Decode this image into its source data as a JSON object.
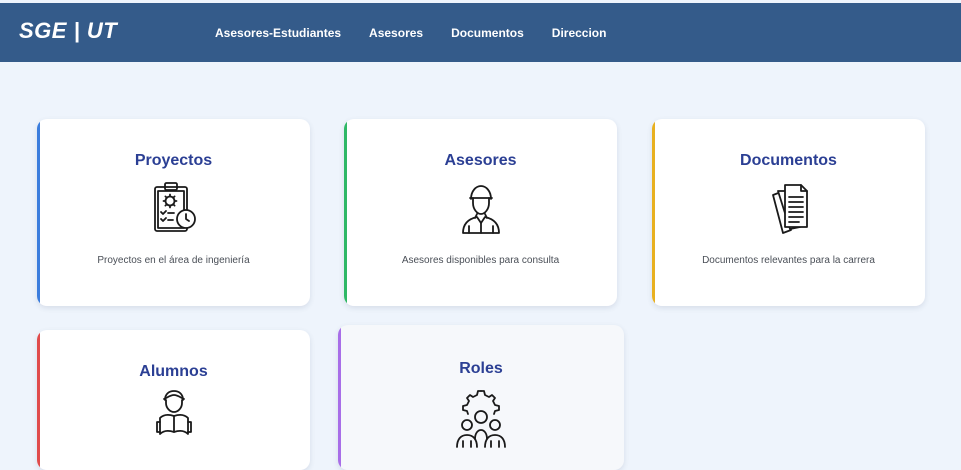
{
  "navbar": {
    "brand": "SGE | UT",
    "links": [
      "Asesores-Estudiantes",
      "Asesores",
      "Documentos",
      "Direccion"
    ]
  },
  "cards": [
    {
      "title": "Proyectos",
      "description": "Proyectos en el área de ingeniería",
      "icon": "clipboard-gear-clock-icon",
      "accent": "#3b7ddd"
    },
    {
      "title": "Asesores",
      "description": "Asesores disponibles para consulta",
      "icon": "advisor-person-icon",
      "accent": "#2fb866"
    },
    {
      "title": "Documentos",
      "description": "Documentos relevantes para la carrera",
      "icon": "documents-stack-icon",
      "accent": "#e8b020"
    },
    {
      "title": "Alumnos",
      "description": "",
      "icon": "student-reading-icon",
      "accent": "#e04b4b"
    },
    {
      "title": "Roles",
      "description": "",
      "icon": "roles-team-gear-icon",
      "accent": "#a86ee8"
    }
  ]
}
